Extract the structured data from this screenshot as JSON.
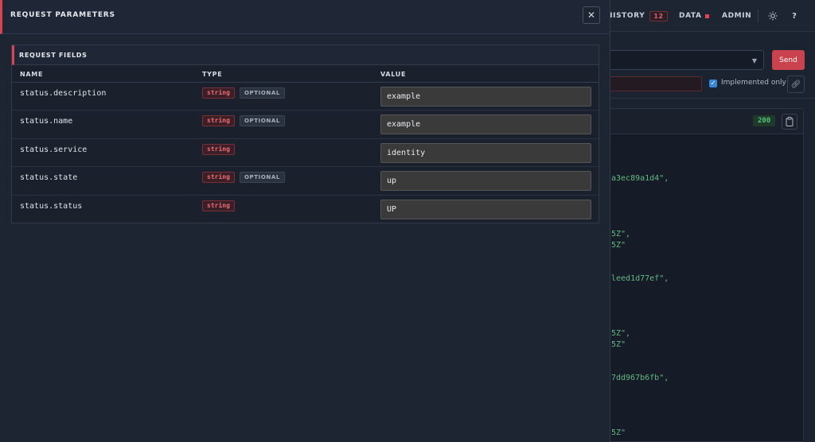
{
  "app": {
    "nav": {
      "history_label": "HISTORY",
      "history_count": "12",
      "data_label": "DATA",
      "admin_label": "ADMIN",
      "theme_icon": "sun-icon",
      "help_label": "?"
    },
    "request_bar": {
      "send_label": "Send",
      "implemented_only_label": "Implemented only",
      "implemented_only_checked": true
    },
    "response": {
      "status_code": "200",
      "visible_fragments": [
        "a3ec89a1d4\",",
        "5Z\",",
        "5Z\"",
        "leed1d77ef\",",
        "5Z\",",
        "5Z\"",
        "7dd967b6fb\",",
        "5Z\""
      ]
    }
  },
  "modal": {
    "title": "REQUEST PARAMETERS",
    "close_label": "✕",
    "fields_panel": {
      "title": "REQUEST FIELDS",
      "columns": {
        "name": "NAME",
        "type": "TYPE",
        "value": "VALUE"
      },
      "rows": [
        {
          "name": "status.description",
          "type": "string",
          "optional": "OPTIONAL",
          "value": "example"
        },
        {
          "name": "status.name",
          "type": "string",
          "optional": "OPTIONAL",
          "value": "example"
        },
        {
          "name": "status.service",
          "type": "string",
          "optional": "",
          "value": "identity"
        },
        {
          "name": "status.state",
          "type": "string",
          "optional": "OPTIONAL",
          "value": "up"
        },
        {
          "name": "status.status",
          "type": "string",
          "optional": "",
          "value": "UP"
        }
      ]
    }
  },
  "colors": {
    "accent": "#d9434f",
    "send_button": "#c9424d",
    "status_ok": "#4fc37a",
    "json_string": "#63b883"
  }
}
